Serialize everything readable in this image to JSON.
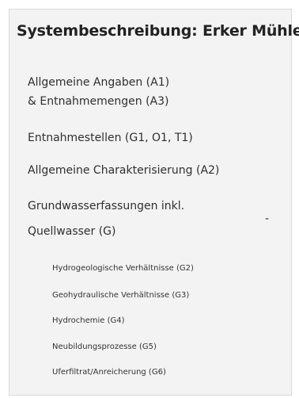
{
  "panel": {
    "title": "Systembeschreibung: Erker Mühle"
  },
  "nav": {
    "items": [
      {
        "lines": [
          "Allgemeine Angaben (A1)",
          "& Entnahmemengen (A3)"
        ]
      },
      {
        "lines": [
          "Entnahmestellen (G1, O1, T1)"
        ]
      },
      {
        "lines": [
          "Allgemeine Charakterisierung (A2)"
        ]
      },
      {
        "lines": [
          "Grundwasserfassungen inkl.",
          "Quellwasser (G)"
        ],
        "toggle": "-"
      }
    ],
    "subitems": [
      "Hydrogeologische Verhältnisse (G2)",
      "Geohydraulische Verhältnisse (G3)",
      "Hydrochemie (G4)",
      "Neubildungsprozesse (G5)",
      "Uferfiltrat/Anreicherung (G6)"
    ]
  }
}
